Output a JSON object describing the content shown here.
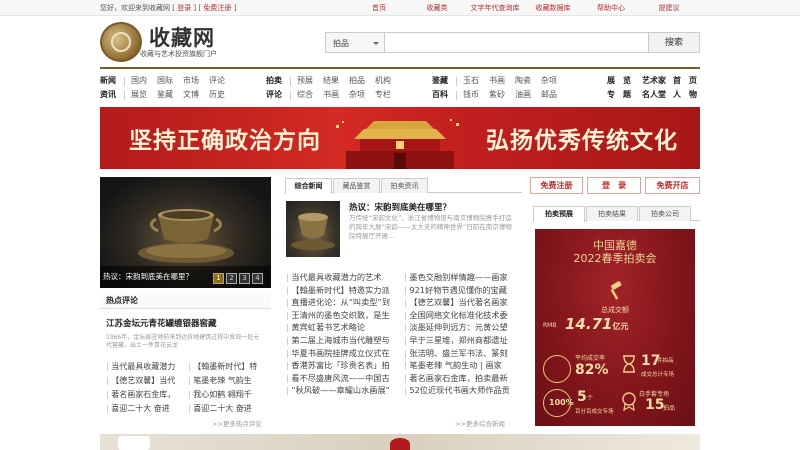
{
  "topbar": {
    "greeting": "您好，欢迎来到收藏网",
    "login": "[ 登录 ]",
    "register": "[ 免费注册 ]",
    "links": [
      "首页",
      "收藏类",
      "文字年代查询库",
      "收藏数据库",
      "帮助中心",
      "提建议"
    ]
  },
  "header": {
    "site_name": "收藏网",
    "slogan": "收藏与艺术投资旗舰门户"
  },
  "search": {
    "category": "拍品",
    "placeholder": "",
    "button": "搜索"
  },
  "nav": {
    "row1": [
      {
        "head": "新闻",
        "items": [
          "国内",
          "国际",
          "市场",
          "评论"
        ]
      },
      {
        "head": "拍卖",
        "items": [
          "预展",
          "结果",
          "拍品",
          "机构"
        ]
      },
      {
        "head": "鉴藏",
        "items": [
          "玉石",
          "书画",
          "陶瓷",
          "杂项"
        ]
      }
    ],
    "row2": [
      {
        "head": "资讯",
        "items": [
          "展览",
          "鉴藏",
          "文博",
          "历史"
        ]
      },
      {
        "head": "评论",
        "items": [
          "综合",
          "书画",
          "杂项",
          "专栏"
        ]
      },
      {
        "head": "百科",
        "items": [
          "钱币",
          "紫砂",
          "油画",
          "邮品"
        ]
      }
    ],
    "right_row1": [
      "展　览",
      "艺术家",
      "首　页"
    ],
    "right_row2": [
      "专　题",
      "名人堂",
      "人　物"
    ]
  },
  "banner": {
    "left_text": "坚持正确政治方向",
    "right_text": "弘扬优秀传统文化"
  },
  "feature": {
    "caption": "热议：宋韵到底美在哪里？",
    "pages": [
      "1",
      "2",
      "3",
      "4"
    ],
    "active_page": "1"
  },
  "hot_comment": {
    "header": "热点评论",
    "title": "江苏金坛元青花罐缠银器窖藏",
    "desc": "1966年，金坛县驻地前来到达拆地建筑过程中发现一处元代窖藏，出土一件青花云龙",
    "items": [
      "当代最具收藏潜力",
      "【翰墨新时代】特",
      "【德艺双馨】当代",
      "笔墨老辣 气韵生",
      "著名画家石金库，",
      "我心如鹤 翱翔千",
      "喜迎二十大 奋进",
      "喜迎二十大 奋进"
    ],
    "more": ">>更多热点评论"
  },
  "middle": {
    "tabs": [
      "综合新闻",
      "藏品鉴赏",
      "拍卖资讯"
    ],
    "active_tab": "综合新闻",
    "hot_title": "热议：宋韵到底美在哪里？",
    "hot_desc": "万传统“宋韵文化”，浙江省博物馆与南京博物院携手打造的跨年大展“宋韵——太大夫的精神世界”日前在南京博物院特展厅开展...",
    "items": [
      "当代最具收藏潜力的艺术",
      "墨色交融别样情趣——画家",
      "【翰墨新时代】特邀实力派",
      "921好物节遇见懂你的宝藏",
      "直播进化论：从“叫卖型”到",
      "【德艺双馨】当代著名画家",
      "王清州的墨色交织致，是生",
      "全国网络文化标准化技术委",
      "黄宾虹著书艺术略论",
      "淡墨延伸到远方：元黄公望",
      "第二届上海城市当代雕塑与",
      "早于三星堆，郑州商都遗址",
      "华夏书画院挂牌成立仪式在",
      "张洁明、盛兰军书法、篆刻",
      "香港苏富比「珍贵名表」拍",
      "笔墨老辣 气韵生动 | 画家",
      "看不尽盛唐风流——中国古",
      "著名画家石金库，拍卖最新",
      "“秋风破——章耀山水画展”",
      "52位近现代书画大师作品贡"
    ],
    "more": ">>更多综合新闻"
  },
  "right": {
    "buttons": [
      "免费注册",
      "登　录",
      "免费开店"
    ],
    "tabs": [
      "拍卖预展",
      "拍卖结果",
      "拍卖公司"
    ],
    "active_tab": "拍卖预展",
    "auction": {
      "brand": "中国嘉德",
      "event": "2022春季拍卖会",
      "total_label": "总成交额",
      "currency": "RMB",
      "total": "14.71",
      "total_unit": "亿元",
      "rate_label": "平均成交率",
      "rate": "82%",
      "sessions_label": "成交总计专场",
      "sessions": "17",
      "sessions_unit": "件拍品",
      "white_label": "白手套专场",
      "white": "5",
      "white_unit": "个",
      "record_label": "百分百成交专场",
      "record": "15",
      "record_unit": "拍品"
    }
  },
  "colors": {
    "accent_red": "#c0281f",
    "brown": "#7a5b26",
    "banner_red": "#c21f1f"
  }
}
